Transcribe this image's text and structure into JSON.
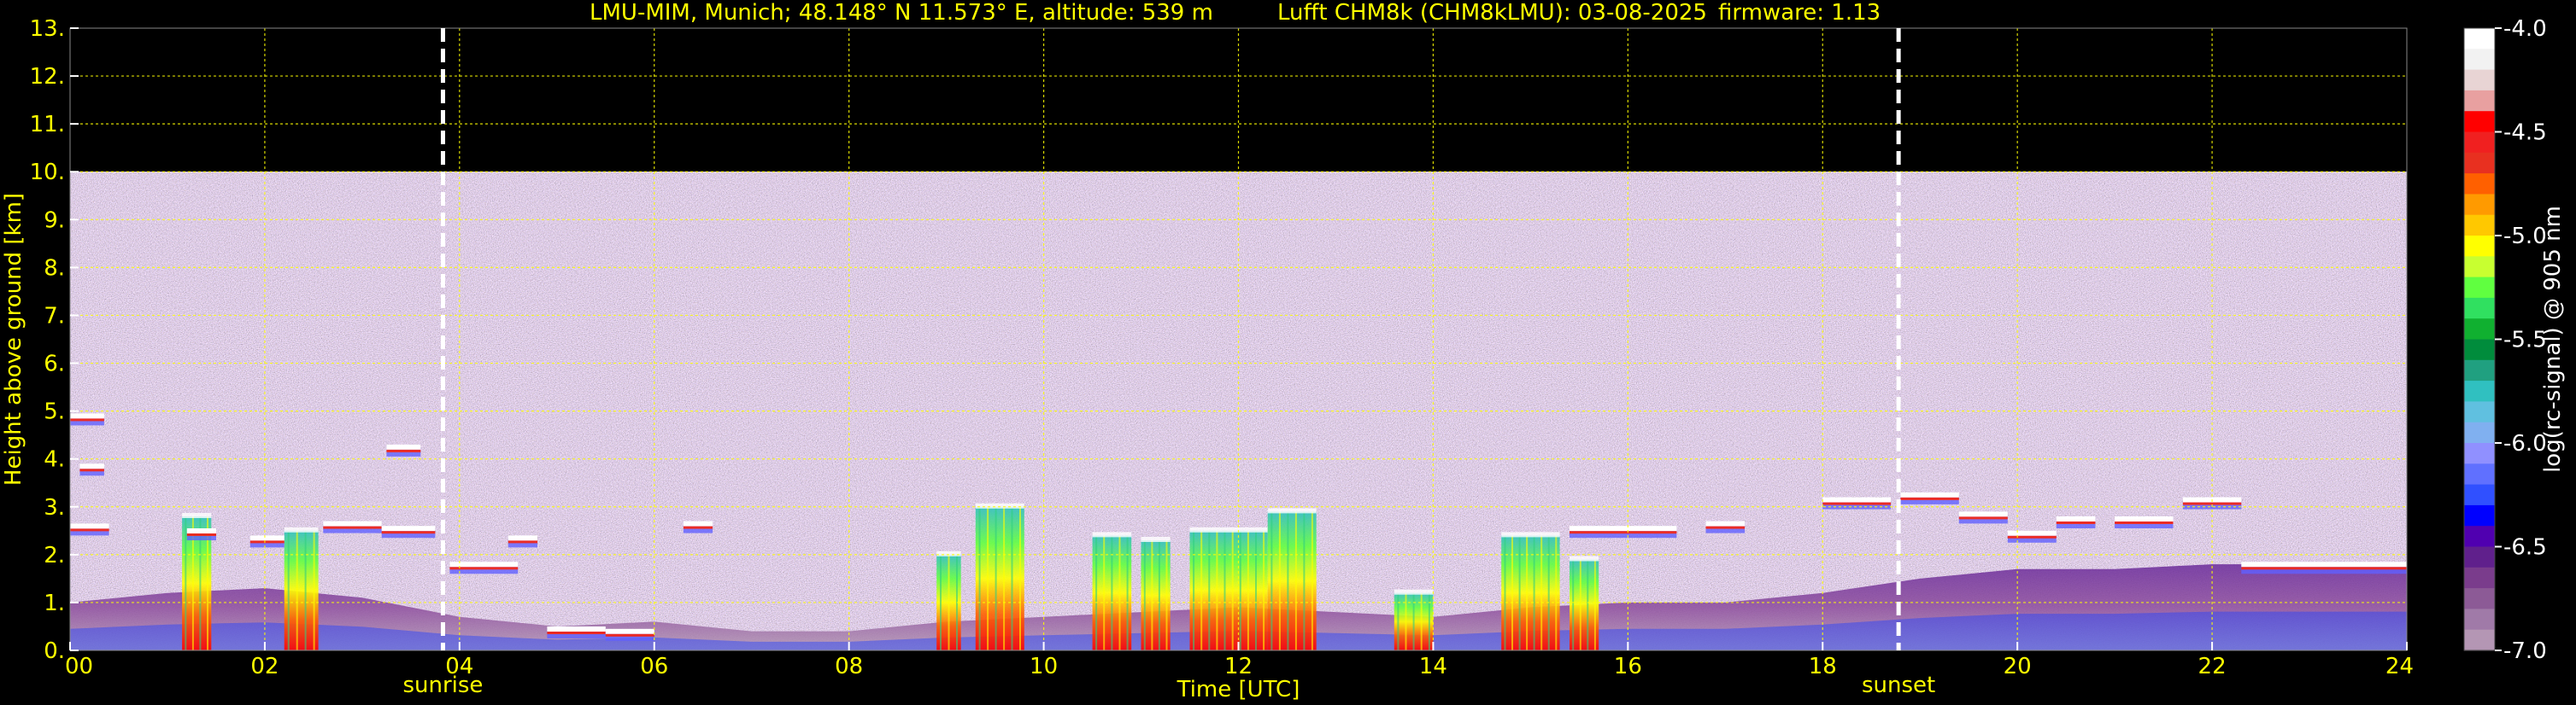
{
  "title": {
    "station": "LMU-MIM, Munich; 48.148° N 11.573° E, altitude: 539 m",
    "instrument": "Lufft CHM8k (CHM8kLMU): 03-08-2025",
    "firmware": "firmware: 1.13"
  },
  "colors": {
    "background": "#000000",
    "text": "#ffff00",
    "grid": "#ffff00",
    "marker_lines": "#ffffff"
  },
  "chart_data": {
    "type": "heatmap",
    "xlabel": "Time [UTC]",
    "ylabel": "Height above ground [km]",
    "xlim": [
      0,
      24
    ],
    "ylim": [
      0,
      13
    ],
    "x_ticks": [
      0,
      2,
      4,
      6,
      8,
      10,
      12,
      14,
      16,
      18,
      20,
      22,
      24
    ],
    "x_tick_labels": [
      "00",
      "02",
      "04",
      "06",
      "08",
      "10",
      "12",
      "14",
      "16",
      "18",
      "20",
      "22",
      "24"
    ],
    "y_ticks": [
      0,
      1,
      2,
      3,
      4,
      5,
      6,
      7,
      8,
      9,
      10,
      11,
      12,
      13
    ],
    "y_tick_labels": [
      "0.",
      "1.",
      "2.",
      "3.",
      "4.",
      "5.",
      "6.",
      "7.",
      "8.",
      "9.",
      "10.",
      "11.",
      "12.",
      "13."
    ],
    "grid": true,
    "data_top_km": 10,
    "markers": [
      {
        "label": "sunrise",
        "time_utc": 3.83
      },
      {
        "label": "sunset",
        "time_utc": 18.78
      }
    ],
    "cloud_layers": [
      {
        "t0": 0.0,
        "t1": 0.35,
        "h": 4.95
      },
      {
        "t0": 0.1,
        "t1": 0.35,
        "h": 3.9
      },
      {
        "t0": 0.0,
        "t1": 0.4,
        "h": 2.65
      },
      {
        "t0": 1.2,
        "t1": 1.5,
        "h": 2.55
      },
      {
        "t0": 1.85,
        "t1": 2.2,
        "h": 2.4
      },
      {
        "t0": 2.6,
        "t1": 3.2,
        "h": 2.7
      },
      {
        "t0": 3.2,
        "t1": 3.75,
        "h": 2.6
      },
      {
        "t0": 3.25,
        "t1": 3.6,
        "h": 4.3
      },
      {
        "t0": 3.9,
        "t1": 4.6,
        "h": 1.85
      },
      {
        "t0": 4.5,
        "t1": 4.8,
        "h": 2.4
      },
      {
        "t0": 4.9,
        "t1": 5.5,
        "h": 0.5
      },
      {
        "t0": 5.5,
        "t1": 6.0,
        "h": 0.45
      },
      {
        "t0": 6.3,
        "t1": 6.6,
        "h": 2.7
      },
      {
        "t0": 15.4,
        "t1": 16.5,
        "h": 2.6
      },
      {
        "t0": 16.8,
        "t1": 17.2,
        "h": 2.7
      },
      {
        "t0": 18.0,
        "t1": 18.7,
        "h": 3.2
      },
      {
        "t0": 18.8,
        "t1": 19.4,
        "h": 3.3
      },
      {
        "t0": 19.4,
        "t1": 19.9,
        "h": 2.9
      },
      {
        "t0": 19.9,
        "t1": 20.4,
        "h": 2.5
      },
      {
        "t0": 20.4,
        "t1": 20.8,
        "h": 2.8
      },
      {
        "t0": 21.0,
        "t1": 21.6,
        "h": 2.8
      },
      {
        "t0": 21.7,
        "t1": 22.3,
        "h": 3.2
      },
      {
        "t0": 22.3,
        "t1": 24.0,
        "h": 1.85
      }
    ],
    "convective_plumes": [
      {
        "t0": 1.15,
        "t1": 1.45,
        "h": 2.8
      },
      {
        "t0": 2.2,
        "t1": 2.55,
        "h": 2.5
      },
      {
        "t0": 8.9,
        "t1": 9.15,
        "h": 2.0
      },
      {
        "t0": 9.3,
        "t1": 9.8,
        "h": 3.0
      },
      {
        "t0": 10.5,
        "t1": 10.9,
        "h": 2.4
      },
      {
        "t0": 11.0,
        "t1": 11.3,
        "h": 2.3
      },
      {
        "t0": 11.5,
        "t1": 12.3,
        "h": 2.5
      },
      {
        "t0": 12.3,
        "t1": 12.8,
        "h": 2.9
      },
      {
        "t0": 13.6,
        "t1": 14.0,
        "h": 1.2
      },
      {
        "t0": 14.7,
        "t1": 15.3,
        "h": 2.4
      },
      {
        "t0": 15.4,
        "t1": 15.7,
        "h": 1.9
      }
    ],
    "colorbar": {
      "label": "log(rc-signal) @ 905 nm",
      "vmin": -7.0,
      "vmax": -4.0,
      "ticks": [
        -4.0,
        -4.5,
        -5.0,
        -5.5,
        -6.0,
        -6.5,
        -7.0
      ],
      "tick_labels": [
        "-4.0",
        "-4.5",
        "-5.0",
        "-5.5",
        "-6.0",
        "-6.5",
        "-7.0"
      ],
      "colors_top_to_bottom": [
        "#ffffff",
        "#f2f2f2",
        "#e8d4d4",
        "#e8a0a0",
        "#ff0000",
        "#f02020",
        "#e83020",
        "#ff6000",
        "#ff9a00",
        "#ffc800",
        "#ffff00",
        "#c8ff30",
        "#60ff40",
        "#30e060",
        "#10b030",
        "#008c3c",
        "#20a080",
        "#30c0c0",
        "#60c0e0",
        "#80b0f0",
        "#9090ff",
        "#6070ff",
        "#3050ff",
        "#0000ff",
        "#5000b0",
        "#60208c",
        "#7a3c8c",
        "#8c5a96",
        "#a07aa8",
        "#b496b4"
      ]
    }
  }
}
